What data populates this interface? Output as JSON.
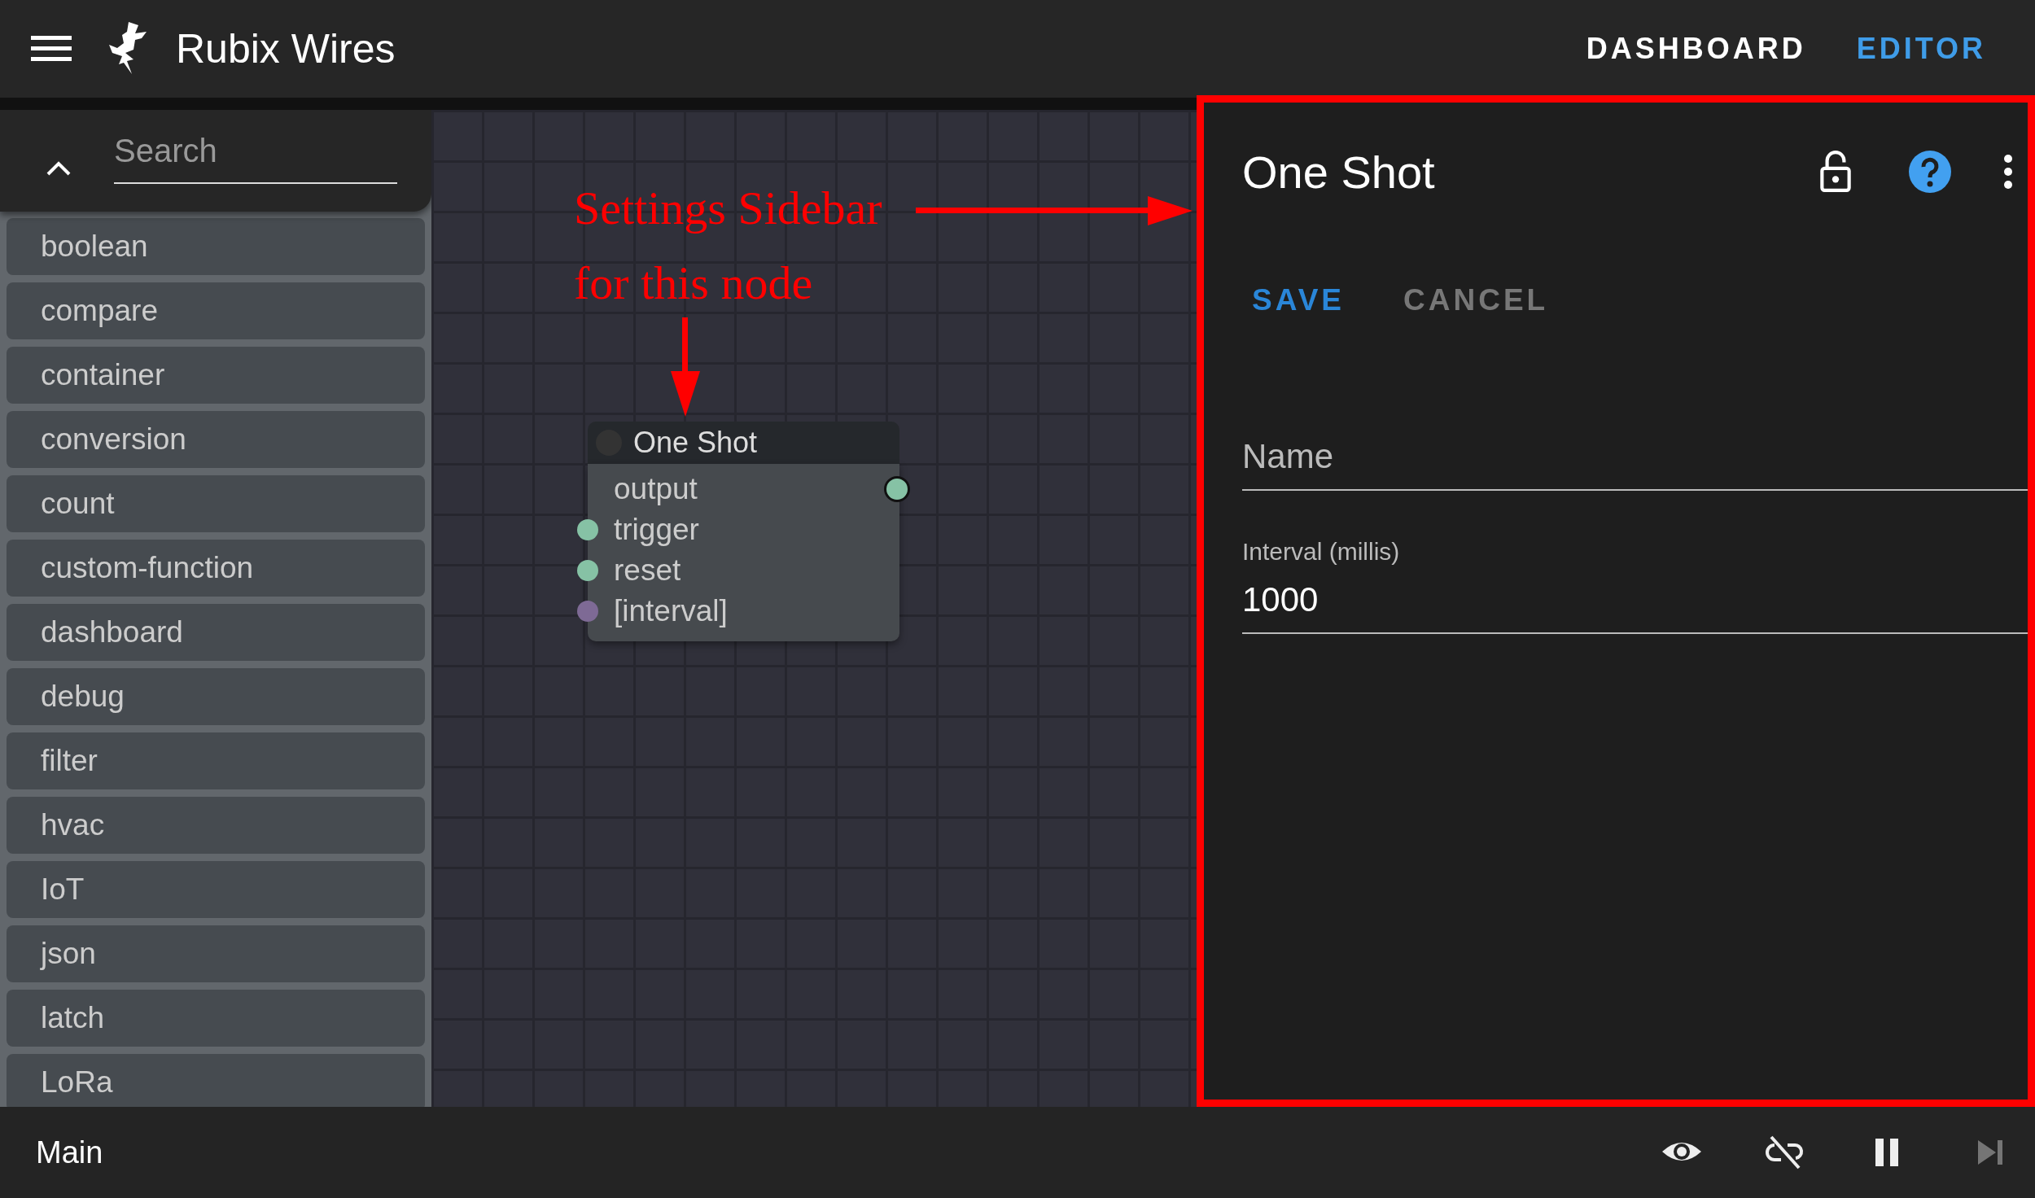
{
  "header": {
    "title": "Rubix Wires",
    "tabs": [
      {
        "label": "DASHBOARD",
        "selected": false
      },
      {
        "label": "EDITOR",
        "selected": true
      }
    ]
  },
  "palette": {
    "search": {
      "placeholder": "Search"
    },
    "categories": [
      "boolean",
      "compare",
      "container",
      "conversion",
      "count",
      "custom-function",
      "dashboard",
      "debug",
      "filter",
      "hvac",
      "IoT",
      "json",
      "latch",
      "LoRa"
    ]
  },
  "canvas": {
    "node": {
      "title": "One Shot",
      "outputs": [
        {
          "label": "output",
          "color": "#86c2a5"
        }
      ],
      "inputs": [
        {
          "label": "trigger",
          "color": "#86c2a5"
        },
        {
          "label": "reset",
          "color": "#86c2a5"
        },
        {
          "label": "[interval]",
          "color": "#7e6a95"
        }
      ]
    },
    "annotation": {
      "lines": [
        "Settings Sidebar",
        "for this node"
      ]
    }
  },
  "settings": {
    "title": "One Shot",
    "actions": [
      {
        "label": "SAVE",
        "kind": "primary"
      },
      {
        "label": "CANCEL",
        "kind": "secondary"
      }
    ],
    "fields": [
      {
        "placeholder": "Name"
      },
      {
        "label": "Interval (millis)",
        "value": "1000"
      }
    ]
  },
  "footer": {
    "label": "Main",
    "controls": [
      {
        "kind": "eye",
        "disabled": false
      },
      {
        "kind": "unlink",
        "disabled": false
      },
      {
        "kind": "pause",
        "disabled": false
      },
      {
        "kind": "step",
        "disabled": true
      }
    ]
  }
}
